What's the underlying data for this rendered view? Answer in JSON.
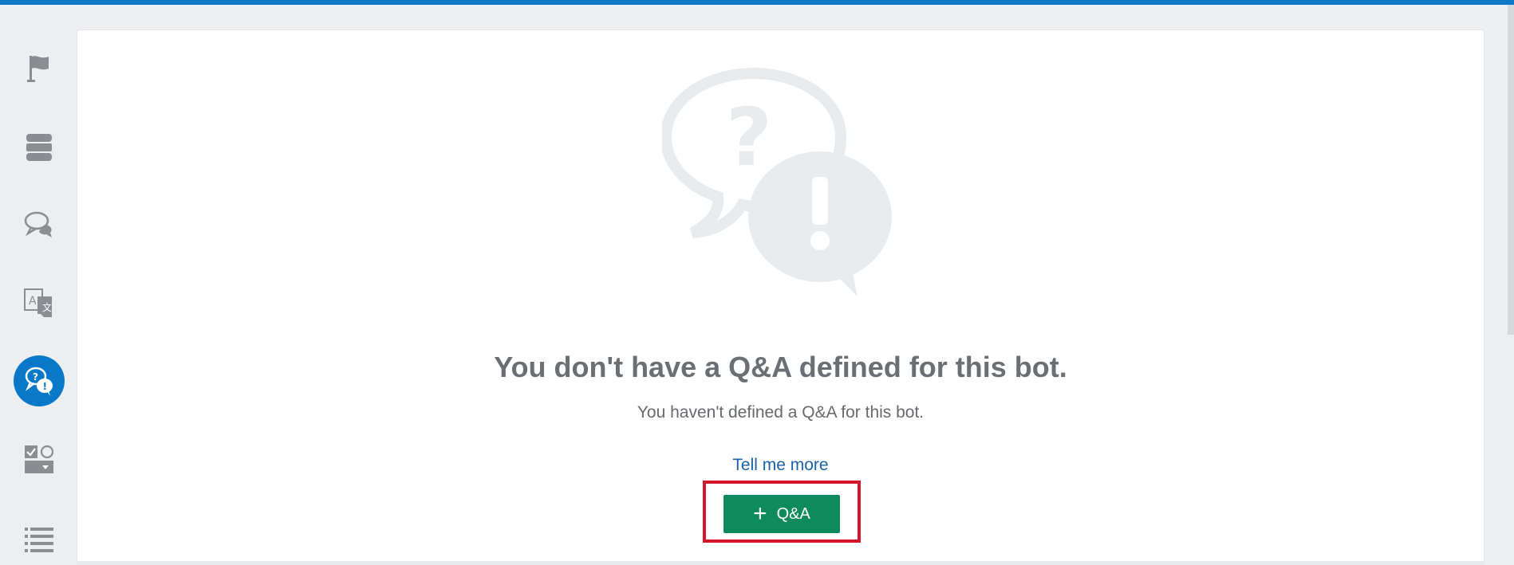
{
  "colors": {
    "accent": "#0a78c8",
    "primary_button": "#0f8a5c",
    "highlight": "#d5172b",
    "link": "#1a62a8"
  },
  "sidebar": {
    "items": [
      {
        "icon": "flag-icon",
        "active": false
      },
      {
        "icon": "database-icon",
        "active": false
      },
      {
        "icon": "chat-bubbles-icon",
        "active": false
      },
      {
        "icon": "translate-icon",
        "active": false
      },
      {
        "icon": "qna-icon",
        "active": true
      },
      {
        "icon": "checkbox-shapes-icon",
        "active": false
      },
      {
        "icon": "list-icon",
        "active": false
      }
    ]
  },
  "empty_state": {
    "illustration": "qna-bubbles-illustration",
    "title": "You don't have a Q&A defined for this bot.",
    "subtitle": "You haven't defined a Q&A for this bot.",
    "link_label": "Tell me more",
    "button_icon": "+",
    "button_label": "Q&A"
  }
}
